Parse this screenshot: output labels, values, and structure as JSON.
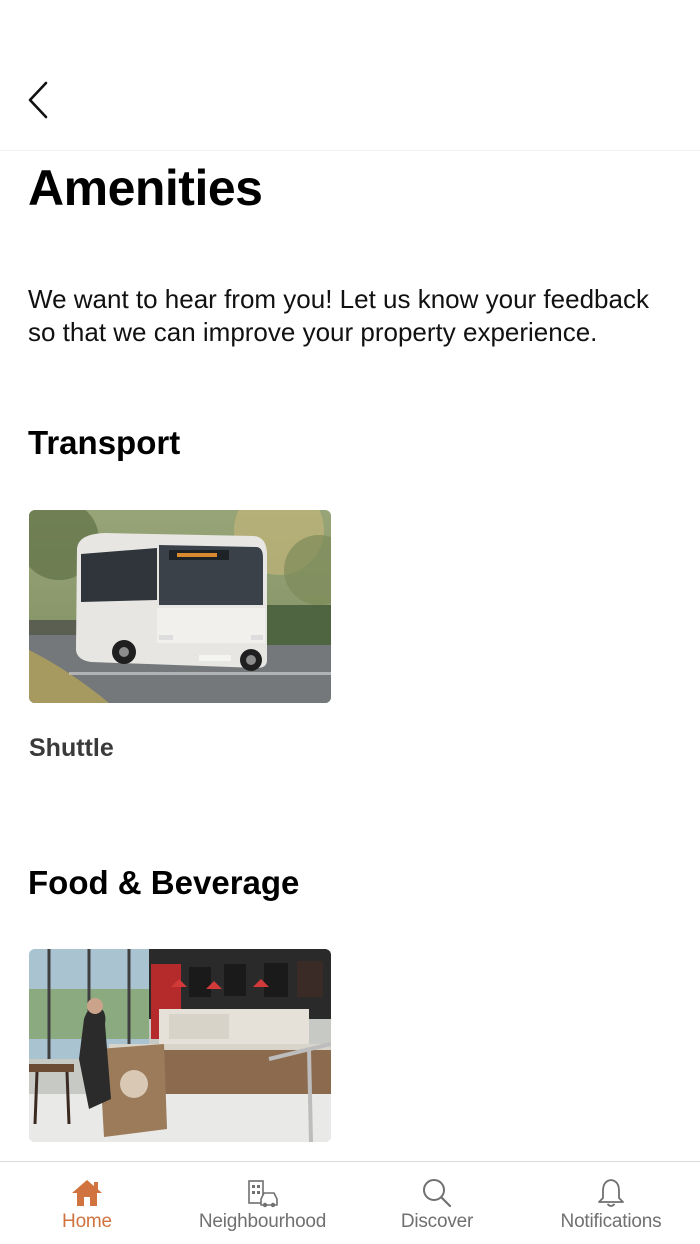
{
  "header": {
    "back_icon": "chevron-left-icon",
    "title": "Amenities"
  },
  "intro_text": "We want to hear from you! Let us know your feedback so that we can improve your property experience.",
  "sections": [
    {
      "title": "Transport",
      "items": [
        {
          "label": "Shuttle",
          "image": "shuttle-bus-photo"
        }
      ]
    },
    {
      "title": "Food & Beverage",
      "items": [
        {
          "label": "",
          "image": "cafe-interior-photo"
        }
      ]
    }
  ],
  "tab_bar": {
    "tabs": [
      {
        "label": "Home",
        "icon": "home-icon",
        "active": true
      },
      {
        "label": "Neighbourhood",
        "icon": "neighbourhood-icon",
        "active": false
      },
      {
        "label": "Discover",
        "icon": "search-icon",
        "active": false
      },
      {
        "label": "Notifications",
        "icon": "bell-icon",
        "active": false
      }
    ]
  },
  "colors": {
    "accent": "#d0733f",
    "inactive_tab": "#707070",
    "text_primary": "#000000"
  }
}
